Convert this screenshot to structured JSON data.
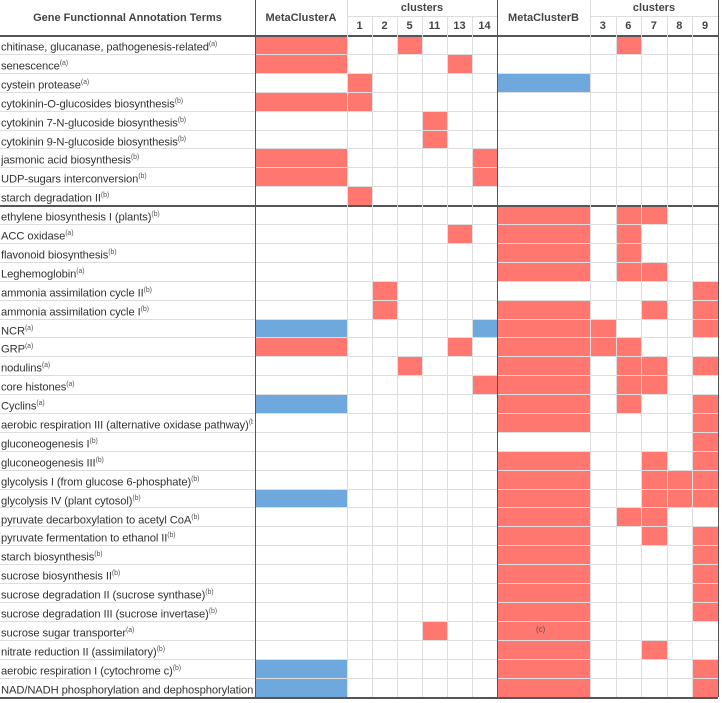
{
  "chart_data": {
    "type": "heatmap",
    "header": {
      "terms_label": "Gene Functionnal Annotation Terms",
      "metaA_label": "MetaClusterA",
      "metaB_label": "MetaClusterB",
      "clusters_label_A": "clusters",
      "clusters_label_B": "clusters"
    },
    "columns": [
      "MetaClusterA",
      "1",
      "2",
      "5",
      "11",
      "13",
      "14",
      "MetaClusterB",
      "3",
      "6",
      "7",
      "8",
      "9"
    ],
    "cell_colors": {
      "r": "#ff776e",
      "b": "#6fa8dc"
    },
    "rows": [
      {
        "term": "chitinase, glucanase, pathogenesis-related",
        "sup": "(a)",
        "cells": "r..r.....r..."
      },
      {
        "term": "senescence",
        "sup": "(a)",
        "cells": "r....r......."
      },
      {
        "term": "cystein protease",
        "sup": "(a)",
        "cells": ".r.....b....."
      },
      {
        "term": "cytokinin-O-glucosides biosynthesis",
        "sup": "(b)",
        "cells": "rr..........."
      },
      {
        "term": "cytokinin 7-N-glucoside biosynthesis",
        "sup": "(b)",
        "cells": "....r........"
      },
      {
        "term": "cytokinin 9-N-glucoside biosynthesis",
        "sup": "(b)",
        "cells": "....r........"
      },
      {
        "term": "jasmonic acid biosynthesis",
        "sup": "(b)",
        "cells": "r.....r......"
      },
      {
        "term": "UDP-sugars interconversion",
        "sup": "(b)",
        "cells": "r.....r......"
      },
      {
        "term": "starch degradation II",
        "sup": "(b)",
        "cells": ".r..........."
      },
      {
        "term": "ethylene biosynthesis I (plants)",
        "sup": "(b)",
        "cells": ".......r.rr.."
      },
      {
        "term": "ACC oxidase",
        "sup": "(a)",
        "cells": ".....r.r.r..."
      },
      {
        "term": "flavonoid biosynthesis",
        "sup": "(b)",
        "cells": ".......r.r..."
      },
      {
        "term": "Leghemoglobin",
        "sup": "(a)",
        "cells": ".......r.rr.."
      },
      {
        "term": "ammonia assimilation cycle II",
        "sup": "(b)",
        "cells": "..r.........r"
      },
      {
        "term": "ammonia assimilation cycle I",
        "sup": "(b)",
        "cells": "..r....r..r.r"
      },
      {
        "term": "NCR",
        "sup": "(a)",
        "cells": "b.....brr...r"
      },
      {
        "term": "GRP",
        "sup": "(a)",
        "cells": "r....r.rrr..."
      },
      {
        "term": "nodulins",
        "sup": "(a)",
        "cells": "...r...r.rr.r"
      },
      {
        "term": "core histones",
        "sup": "(a)",
        "cells": "......rr.rr.."
      },
      {
        "term": "Cyclins",
        "sup": "(a)",
        "cells": "b......r.r..r"
      },
      {
        "term": "aerobic respiration III (alternative oxidase pathway)",
        "sup": "(b)",
        "cells": ".......r....r"
      },
      {
        "term": "gluconeogenesis I",
        "sup": "(b)",
        "cells": "............r"
      },
      {
        "term": "gluconeogenesis III",
        "sup": "(b)",
        "cells": ".......r..r.r"
      },
      {
        "term": "glycolysis I (from glucose 6-phosphate)",
        "sup": "(b)",
        "cells": ".......r..rrr"
      },
      {
        "term": "glycolysis IV (plant cytosol)",
        "sup": "(b)",
        "cells": "b......r..rrr"
      },
      {
        "term": "pyruvate decarboxylation to acetyl CoA",
        "sup": "(b)",
        "cells": ".......r.rr.."
      },
      {
        "term": "pyruvate fermentation to ethanol II",
        "sup": "(b)",
        "cells": ".......r..r.r"
      },
      {
        "term": "starch biosynthesis",
        "sup": "(b)",
        "cells": ".......r....r"
      },
      {
        "term": "sucrose biosynthesis II",
        "sup": "(b)",
        "cells": ".......r....r"
      },
      {
        "term": "sucrose degradation II (sucrose synthase)",
        "sup": "(b)",
        "cells": ".......r....r"
      },
      {
        "term": "sucrose degradation III (sucrose invertase)",
        "sup": "(b)",
        "cells": ".......r....r"
      },
      {
        "term": "sucrose sugar transporter",
        "sup": "(a)",
        "cells": "....r..r....."
      },
      {
        "term": "nitrate reduction II (assimilatory)",
        "sup": "(b)",
        "cells": ".......r..r.."
      },
      {
        "term": "aerobic respiration I (cytochrome c)",
        "sup": "(b)",
        "cells": "b......r....r"
      },
      {
        "term": "NAD/NADH phosphorylation and dephosphorylation",
        "sup": "(b)",
        "cells": "b......r....r"
      }
    ],
    "annotation": "(c)"
  }
}
